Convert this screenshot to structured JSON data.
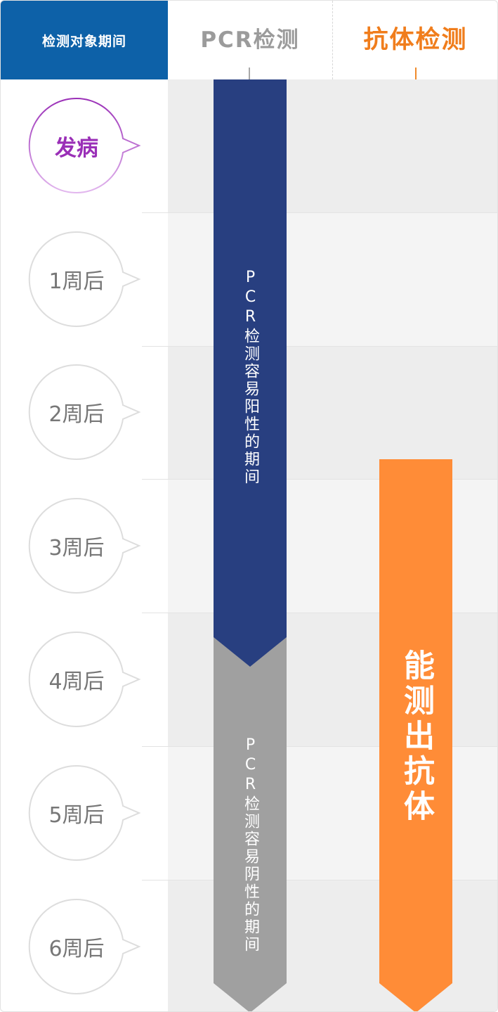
{
  "header": {
    "period_label": "检测对象期间",
    "pcr_label": "PCR检测",
    "antibody_label": "抗体检测"
  },
  "periods": [
    {
      "label": "发病"
    },
    {
      "label": "1周后"
    },
    {
      "label": "2周后"
    },
    {
      "label": "3周后"
    },
    {
      "label": "4周后"
    },
    {
      "label": "5周后"
    },
    {
      "label": "6周后"
    }
  ],
  "bars": {
    "pcr_positive": "PCR检测容易阳性的期间",
    "pcr_negative": "PCR检测容易阴性的期间",
    "antibody": "能测出抗体"
  },
  "colors": {
    "header_blue": "#0d61a8",
    "pcr_gray": "#9b9b9b",
    "antibody_orange": "#f07d1c",
    "pcr_positive_bar": "#283f80",
    "pcr_negative_bar": "#a0a0a0",
    "antibody_bar": "#ff8c37",
    "onset_purple": "#9a2fb7"
  }
}
